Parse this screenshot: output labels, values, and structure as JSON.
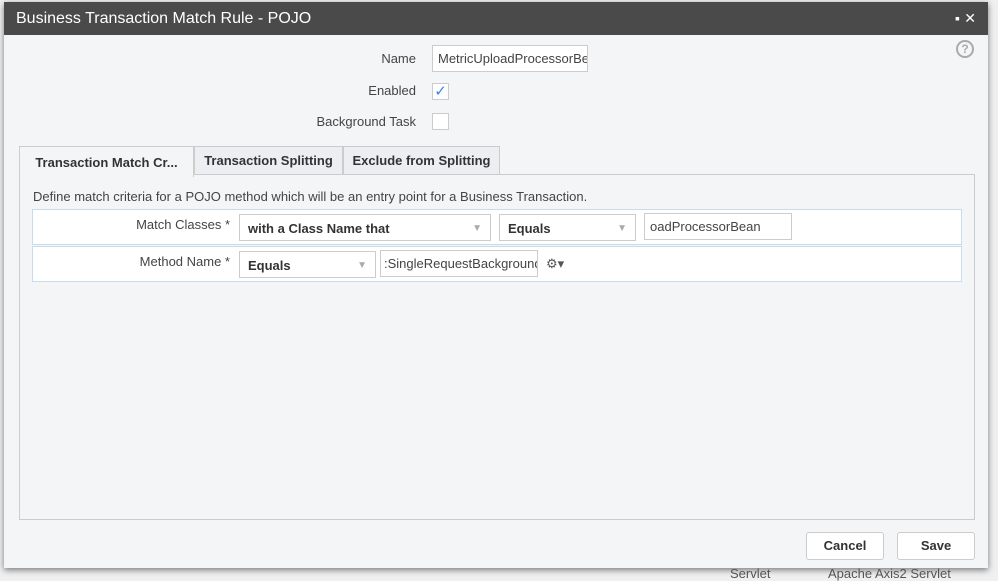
{
  "background": {
    "cell1": "Servlet",
    "cell2": "Apache Axis2 Servlet"
  },
  "dialog": {
    "title": "Business Transaction Match Rule - POJO",
    "maximize_icon": "▪",
    "close_icon": "✕",
    "help_icon": "?",
    "name_label": "Name",
    "name_value": "MetricUploadProcessorBea",
    "enabled_label": "Enabled",
    "enabled_checked": true,
    "check_glyph": "✓",
    "background_task_label": "Background Task",
    "background_task_checked": false,
    "tabs": [
      {
        "label": "Transaction Match Cr...",
        "active": true
      },
      {
        "label": "Transaction Splitting"
      },
      {
        "label": "Exclude from Splitting"
      }
    ],
    "description": "Define match criteria for a POJO method which will be an entry point for a Business Transaction.",
    "match_classes": {
      "label": "Match Classes *",
      "type": "with a Class Name that",
      "operator": "Equals",
      "value": "oadProcessorBean"
    },
    "method_name": {
      "label": "Method Name *",
      "operator": "Equals",
      "value": ":SingleRequestBackground",
      "gear_icon": "⚙▾"
    },
    "arrow": "▼",
    "cancel": "Cancel",
    "save": "Save"
  }
}
